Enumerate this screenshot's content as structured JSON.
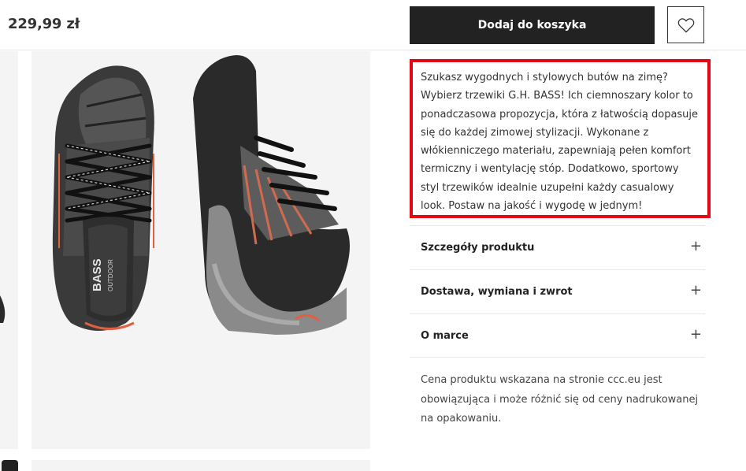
{
  "header": {
    "price": "229,99 zł",
    "add_to_cart_label": "Dodaj do koszyka",
    "wishlist_icon": "heart-icon"
  },
  "description": {
    "text": "Szukasz wygodnych i stylowych butów na zimę? Wybierz trzewiki G.H. BASS! Ich ciemnoszary kolor to ponadczasowa propozycja, która z łatwością dopasuje się do każdej zimowej stylizacji. Wykonane z włókienniczego materiału, zapewniają pełen komfort termiczny i wentylację stóp. Dodatkowo, sportowy styl trzewików idealnie uzupełni każdy casualowy look. Postaw na jakość i wygodę w jednym!",
    "highlight_color": "#e30613"
  },
  "accordion": [
    {
      "label": "Szczegóły produktu",
      "icon": "plus-icon"
    },
    {
      "label": "Dostawa, wymiana i zwrot",
      "icon": "plus-icon"
    },
    {
      "label": "O marce",
      "icon": "plus-icon"
    }
  ],
  "price_note": "Cena produktu wskazana na stronie ccc.eu jest obowiązująca i może różnić się od ceny nadrukowanej na opakowaniu.",
  "product_image": {
    "brand_text": "BASS",
    "sub_text": "OUTDOOR"
  }
}
